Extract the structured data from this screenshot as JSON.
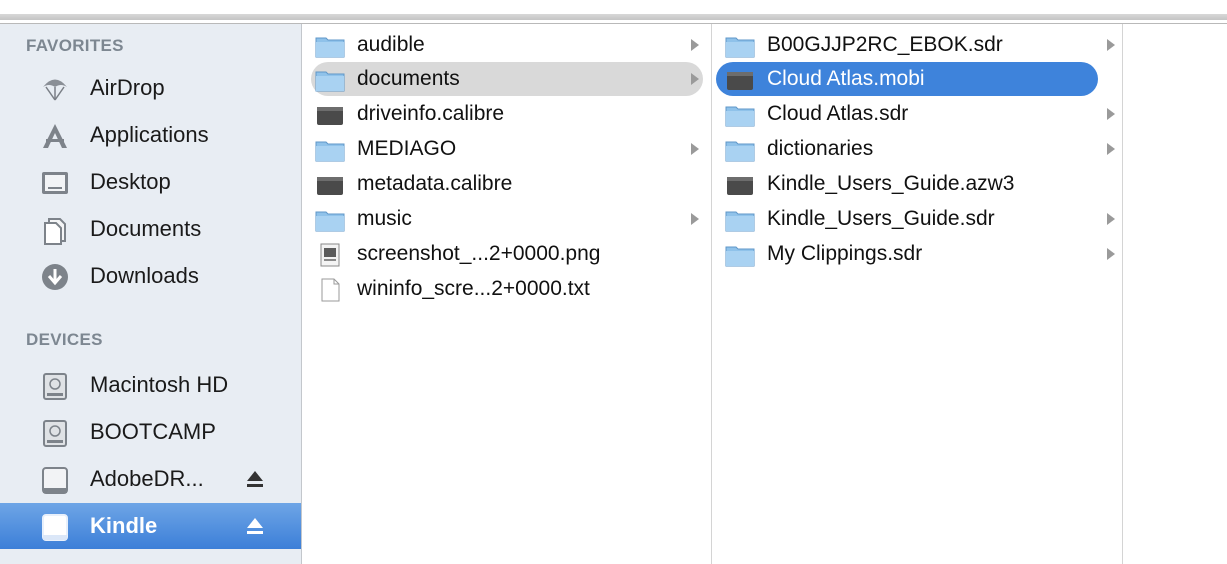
{
  "sidebar": {
    "favorites_header": "FAVORITES",
    "devices_header": "DEVICES",
    "favorites": [
      {
        "label": "AirDrop",
        "icon": "airdrop-icon"
      },
      {
        "label": "Applications",
        "icon": "applications-icon"
      },
      {
        "label": "Desktop",
        "icon": "desktop-icon"
      },
      {
        "label": "Documents",
        "icon": "documents-icon"
      },
      {
        "label": "Downloads",
        "icon": "downloads-icon"
      }
    ],
    "devices": [
      {
        "label": "Macintosh HD",
        "icon": "hard-drive-icon"
      },
      {
        "label": "BOOTCAMP",
        "icon": "hard-drive-icon"
      },
      {
        "label": "AdobeDR...",
        "icon": "external-drive-icon",
        "eject": true
      },
      {
        "label": "Kindle",
        "icon": "external-drive-icon",
        "eject": true,
        "selected": true
      }
    ]
  },
  "column1": [
    {
      "label": "audible",
      "type": "folder",
      "has_children": true
    },
    {
      "label": "documents",
      "type": "folder",
      "has_children": true,
      "in_path": true
    },
    {
      "label": "driveinfo.calibre",
      "type": "file-dark"
    },
    {
      "label": "MEDIAGO",
      "type": "folder",
      "has_children": true
    },
    {
      "label": "metadata.calibre",
      "type": "file-dark"
    },
    {
      "label": "music",
      "type": "folder",
      "has_children": true
    },
    {
      "label": "screenshot_...2+0000.png",
      "type": "image"
    },
    {
      "label": "wininfo_scre...2+0000.txt",
      "type": "text"
    }
  ],
  "column2": [
    {
      "label": "B00GJJP2RC_EBOK.sdr",
      "type": "folder",
      "has_children": true
    },
    {
      "label": "Cloud Atlas.mobi",
      "type": "file-dark",
      "selected": true
    },
    {
      "label": "Cloud Atlas.sdr",
      "type": "folder",
      "has_children": true
    },
    {
      "label": "dictionaries",
      "type": "folder",
      "has_children": true
    },
    {
      "label": "Kindle_Users_Guide.azw3",
      "type": "file-dark"
    },
    {
      "label": "Kindle_Users_Guide.sdr",
      "type": "folder",
      "has_children": true
    },
    {
      "label": "My Clippings.sdr",
      "type": "folder",
      "has_children": true
    }
  ],
  "colors": {
    "sidebar_bg": "#e8edf3",
    "selection": "#3e83db",
    "path_highlight": "#d9d9d9",
    "folder": "#8fc2ea"
  }
}
